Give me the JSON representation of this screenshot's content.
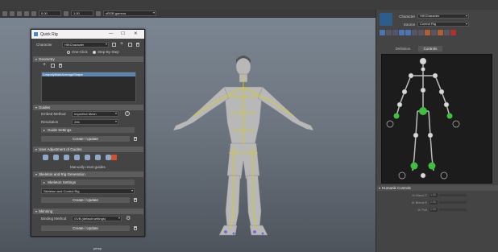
{
  "toolbar": {
    "num1": "0.00",
    "num2": "1.00",
    "colorspace": "sRGB gamma"
  },
  "viewport": {
    "camera_label": "persp"
  },
  "right_panel": {
    "character_label": "Character",
    "character_value": "HIKCharacter",
    "source_label": "Source",
    "source_value": "Control Rig",
    "tabs": [
      "Definition",
      "Controls"
    ],
    "active_tab": "Controls",
    "section_title": "Humanik Controls",
    "attrs": [
      {
        "label": "IK Blend T",
        "value": "1.00"
      },
      {
        "label": "IK Blend R",
        "value": "1.00"
      },
      {
        "label": "IK Pull",
        "value": "1.00"
      }
    ]
  },
  "quick_rig": {
    "title": "Quick Rig",
    "character_label": "Character",
    "character_value": "HIKCharacter",
    "mode_one_click": "One-Click",
    "mode_step": "Step-By-Step",
    "geometry_header": "Geometry",
    "geometry_item": "LowpolyMaleAverageShape",
    "guides_header": "Guides",
    "embed_label": "Embed Method",
    "embed_value": "Imperfect Mesh",
    "resolution_label": "Resolution",
    "resolution_value": "256",
    "guide_settings": "Guide Settings",
    "create_update": "Create / Update",
    "user_adjust_header": "User Adjustment of Guides",
    "manual_guides_text": "Manually reset guides",
    "skeleton_header": "Skeleton and Rig Generation",
    "skeleton_settings": "Skeleton Settings",
    "skeleton_dropdown": "Skeleton and Control Rig",
    "skinning_header": "Skinning",
    "binding_label": "Binding Method",
    "binding_value": "GVB (default settings)"
  }
}
